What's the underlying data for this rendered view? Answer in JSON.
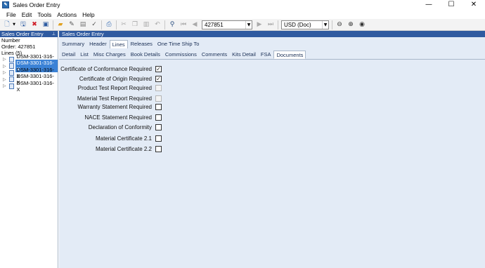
{
  "window": {
    "title": "Sales Order Entry",
    "icon": "app-icon",
    "controls": [
      "—",
      "☐",
      "✕"
    ]
  },
  "menu": [
    "File",
    "Edit",
    "Tools",
    "Actions",
    "Help"
  ],
  "toolbar": {
    "order_number": "427851",
    "currency": "USD (Doc)"
  },
  "left_panel": {
    "header": "Sales Order Entry",
    "number_label": "Number",
    "order_line": "Order: 427851",
    "lines_label": "Lines (5)",
    "items": [
      {
        "label": "DSM-3301-316-X",
        "selected": false
      },
      {
        "label": "DSM-3301-316-X",
        "selected": true
      },
      {
        "label": "DSM-3301-316-X",
        "selected": false
      },
      {
        "label": "DSM-3301-316-X",
        "selected": false
      },
      {
        "label": "DSM-3301-316-X",
        "selected": false
      }
    ]
  },
  "right_panel": {
    "header": "Sales Order Entry",
    "tabs": [
      "Summary",
      "Header",
      "Lines",
      "Releases",
      "One Time Ship To"
    ],
    "active_tab": "Lines",
    "subtabs": [
      "Detail",
      "List",
      "Misc Charges",
      "Book Details",
      "Commissions",
      "Comments",
      "Kits Detail",
      "FSA",
      "Documents"
    ],
    "active_subtab": "Documents"
  },
  "documents": [
    {
      "label": "Certificate of Conformance Required",
      "checked": true,
      "enabled": true
    },
    {
      "label": "Certificate of Origin Required",
      "checked": true,
      "enabled": true
    },
    {
      "label": "Product Test Report Required",
      "checked": false,
      "enabled": false
    },
    {
      "label": "Material Test Report Required",
      "checked": false,
      "enabled": false
    },
    {
      "label": "Warranty Statement Required",
      "checked": false,
      "enabled": true
    },
    {
      "label": "NACE Statement Required",
      "checked": false,
      "enabled": true
    },
    {
      "label": "Declaration of Conformity",
      "checked": false,
      "enabled": true
    },
    {
      "label": "Material Certificate 2.1",
      "checked": false,
      "enabled": true
    },
    {
      "label": "Material Certificate 2.2",
      "checked": false,
      "enabled": true
    }
  ],
  "colors": {
    "header_blue": "#2f5aa0",
    "panel_bg": "#e3ebf6",
    "selection": "#3b82d6"
  }
}
